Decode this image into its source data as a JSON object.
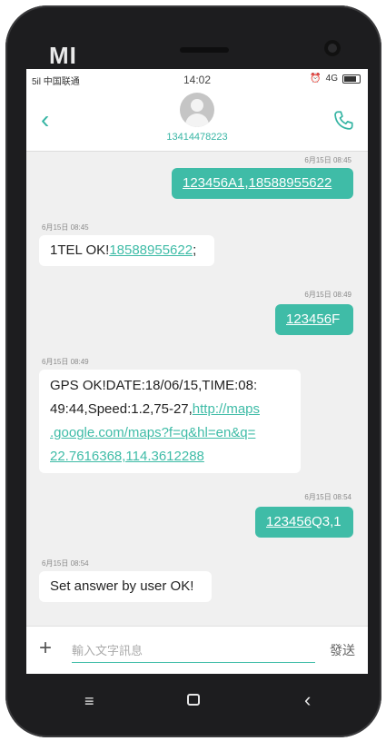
{
  "device": {
    "brand": "mi"
  },
  "statusbar": {
    "carrier": "5il 中国联通",
    "time": "14:02",
    "network": "4G"
  },
  "header": {
    "contact_number": "13414478223"
  },
  "messages": [
    {
      "direction": "out",
      "timestamp": "6月15日 08:45",
      "text_plain": "",
      "text_link": "123456A1,18588955622",
      "text_tail": ""
    },
    {
      "direction": "in",
      "timestamp": "6月15日 08:45",
      "text_plain": "1TEL OK!",
      "text_link": "18588955622",
      "text_tail": ";"
    },
    {
      "direction": "out",
      "timestamp": "6月15日 08:49",
      "text_plain": "",
      "text_link": "123456",
      "text_tail": "F"
    },
    {
      "direction": "in",
      "timestamp": "6月15日 08:49",
      "text_line1": "GPS OK!DATE:18/06/15,TIME:08:",
      "text_line2a": "49:44,Speed:1.2,75-27,",
      "text_line2b": "http://maps",
      "text_line3": ".google.com/maps?f=q&hl=en&q=",
      "text_line4": "22.7616368,114.3612288"
    },
    {
      "direction": "out",
      "timestamp": "6月15日 08:54",
      "text_plain": "",
      "text_link": "123456",
      "text_tail": "Q3,1"
    },
    {
      "direction": "in",
      "timestamp": "6月15日 08:54",
      "text_plain": "Set answer by user OK!",
      "text_link": "",
      "text_tail": ""
    }
  ],
  "input": {
    "placeholder": "輸入文字訊息",
    "value": ""
  },
  "send_label": "發送",
  "icons": {
    "back": "chevron-left-icon",
    "call": "phone-icon",
    "plus": "plus-icon",
    "nav_menu": "menu-icon",
    "nav_home": "home-square-icon",
    "nav_back": "back-chevron-icon"
  },
  "colors": {
    "accent": "#3fbca7",
    "bubble_in": "#ffffff",
    "background": "#f0f0f0",
    "phone_body": "#1d1d1f"
  }
}
